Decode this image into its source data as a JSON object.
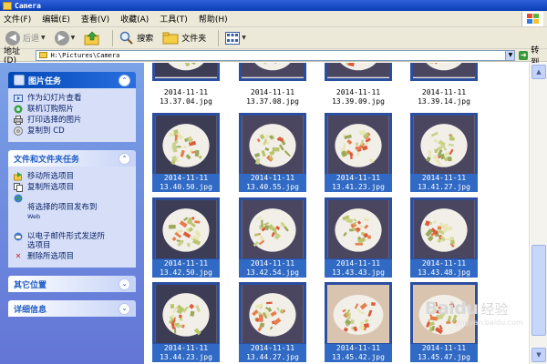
{
  "window": {
    "title": "Camera"
  },
  "menu": [
    "文件(F)",
    "编辑(E)",
    "查看(V)",
    "收藏(A)",
    "工具(T)",
    "帮助(H)"
  ],
  "toolbar": {
    "back": "后退",
    "search": "搜索",
    "folders": "文件夹"
  },
  "address": {
    "label": "地址(D)",
    "value": "H:\\Pictures\\Camera",
    "go": "转到"
  },
  "left_pane": {
    "picture_tasks": {
      "title": "图片任务",
      "items": [
        {
          "label": "作为幻灯片查看",
          "icon": "slideshow-icon"
        },
        {
          "label": "联机订购照片",
          "icon": "order-prints-icon"
        },
        {
          "label": "打印选择的图片",
          "icon": "printer-icon"
        },
        {
          "label": "复制到 CD",
          "icon": "cd-icon"
        }
      ]
    },
    "file_tasks": {
      "title": "文件和文件夹任务",
      "items": [
        {
          "label": "移动所选项目",
          "icon": "move-icon"
        },
        {
          "label": "复制所选项目",
          "icon": "copy-icon"
        },
        {
          "label": "将选择的项目发布到",
          "sub": "Web",
          "icon": "web-publish-icon"
        },
        {
          "label": "以电子邮件形式发送所\n选项目",
          "icon": "email-icon"
        },
        {
          "label": "删除所选项目",
          "icon": "delete-icon"
        }
      ]
    },
    "other_places": {
      "title": "其它位置"
    },
    "details": {
      "title": "详细信息"
    }
  },
  "files": {
    "row0": [
      {
        "line1": "2014-11-11",
        "line2": "13.37.04.jpg"
      },
      {
        "line1": "2014-11-11",
        "line2": "13.37.08.jpg"
      },
      {
        "line1": "2014-11-11",
        "line2": "13.39.09.jpg"
      },
      {
        "line1": "2014-11-11",
        "line2": "13.39.14.jpg"
      }
    ],
    "row1": [
      {
        "line1": "2014-11-11",
        "line2": "13.40.50.jpg"
      },
      {
        "line1": "2014-11-11",
        "line2": "13.40.55.jpg"
      },
      {
        "line1": "2014-11-11",
        "line2": "13.41.23.jpg"
      },
      {
        "line1": "2014-11-11",
        "line2": "13.41.27.jpg"
      }
    ],
    "row2": [
      {
        "line1": "2014-11-11",
        "line2": "13.42.50.jpg"
      },
      {
        "line1": "2014-11-11",
        "line2": "13.42.54.jpg"
      },
      {
        "line1": "2014-11-11",
        "line2": "13.43.43.jpg"
      },
      {
        "line1": "2014-11-11",
        "line2": "13.43.48.jpg"
      }
    ],
    "row3": [
      {
        "line1": "2014-11-11",
        "line2": "13.44.23.jpg"
      },
      {
        "line1": "2014-11-11",
        "line2": "13.44.27.jpg"
      },
      {
        "line1": "2014-11-11",
        "line2": "13.45.42.jpg"
      },
      {
        "line1": "2014-11-11",
        "line2": "13.45.47.jpg"
      }
    ]
  },
  "watermark": {
    "brand": "Baidu",
    "cn": "经验",
    "url": "jingyan.baidu.com"
  }
}
